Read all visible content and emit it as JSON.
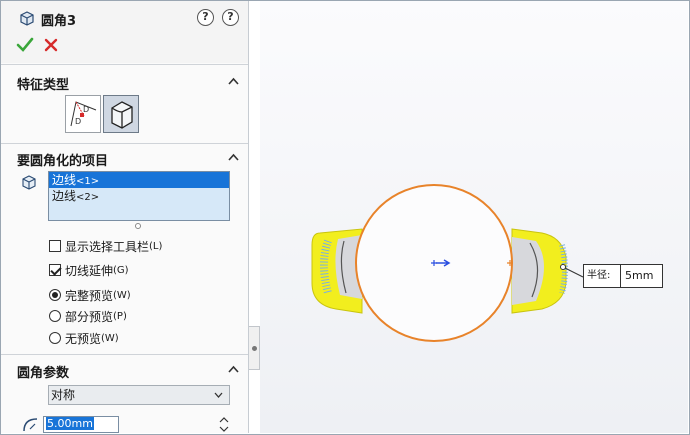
{
  "feature": {
    "title": "圆角3",
    "help_label": "?",
    "help2_label": "?"
  },
  "sections": {
    "fillet_type": {
      "label": "特征类型"
    },
    "items": {
      "label": "要圆角化的项目",
      "edges": [
        {
          "name": "边线",
          "suffix": "<1>",
          "selected": true
        },
        {
          "name": "边线",
          "suffix": "<2>",
          "selected": false
        }
      ]
    },
    "options": {
      "show_toolbar": {
        "label": "显示选择工具栏",
        "hotkey": "(L)",
        "checked": false
      },
      "tangent_propagation": {
        "label": "切线延伸",
        "hotkey": "(G)",
        "checked": true
      },
      "preview_full": {
        "label": "完整预览",
        "hotkey": "(W)",
        "selected": true
      },
      "preview_partial": {
        "label": "部分预览",
        "hotkey": "(P)",
        "selected": false
      },
      "preview_none": {
        "label": "无预览",
        "hotkey": "(W)",
        "selected": false
      }
    },
    "fillet_params": {
      "label": "圆角参数",
      "profile_select": "对称",
      "radius_value": "5.00mm"
    }
  },
  "callout": {
    "key": "半径:",
    "value": "5mm"
  },
  "colors": {
    "accent_blue": "#1874d8",
    "preview_yellow": "#f2ee1e",
    "edge_orange": "#e8832a",
    "ok_green": "#3aa63a",
    "cancel_red": "#d62a2a"
  }
}
